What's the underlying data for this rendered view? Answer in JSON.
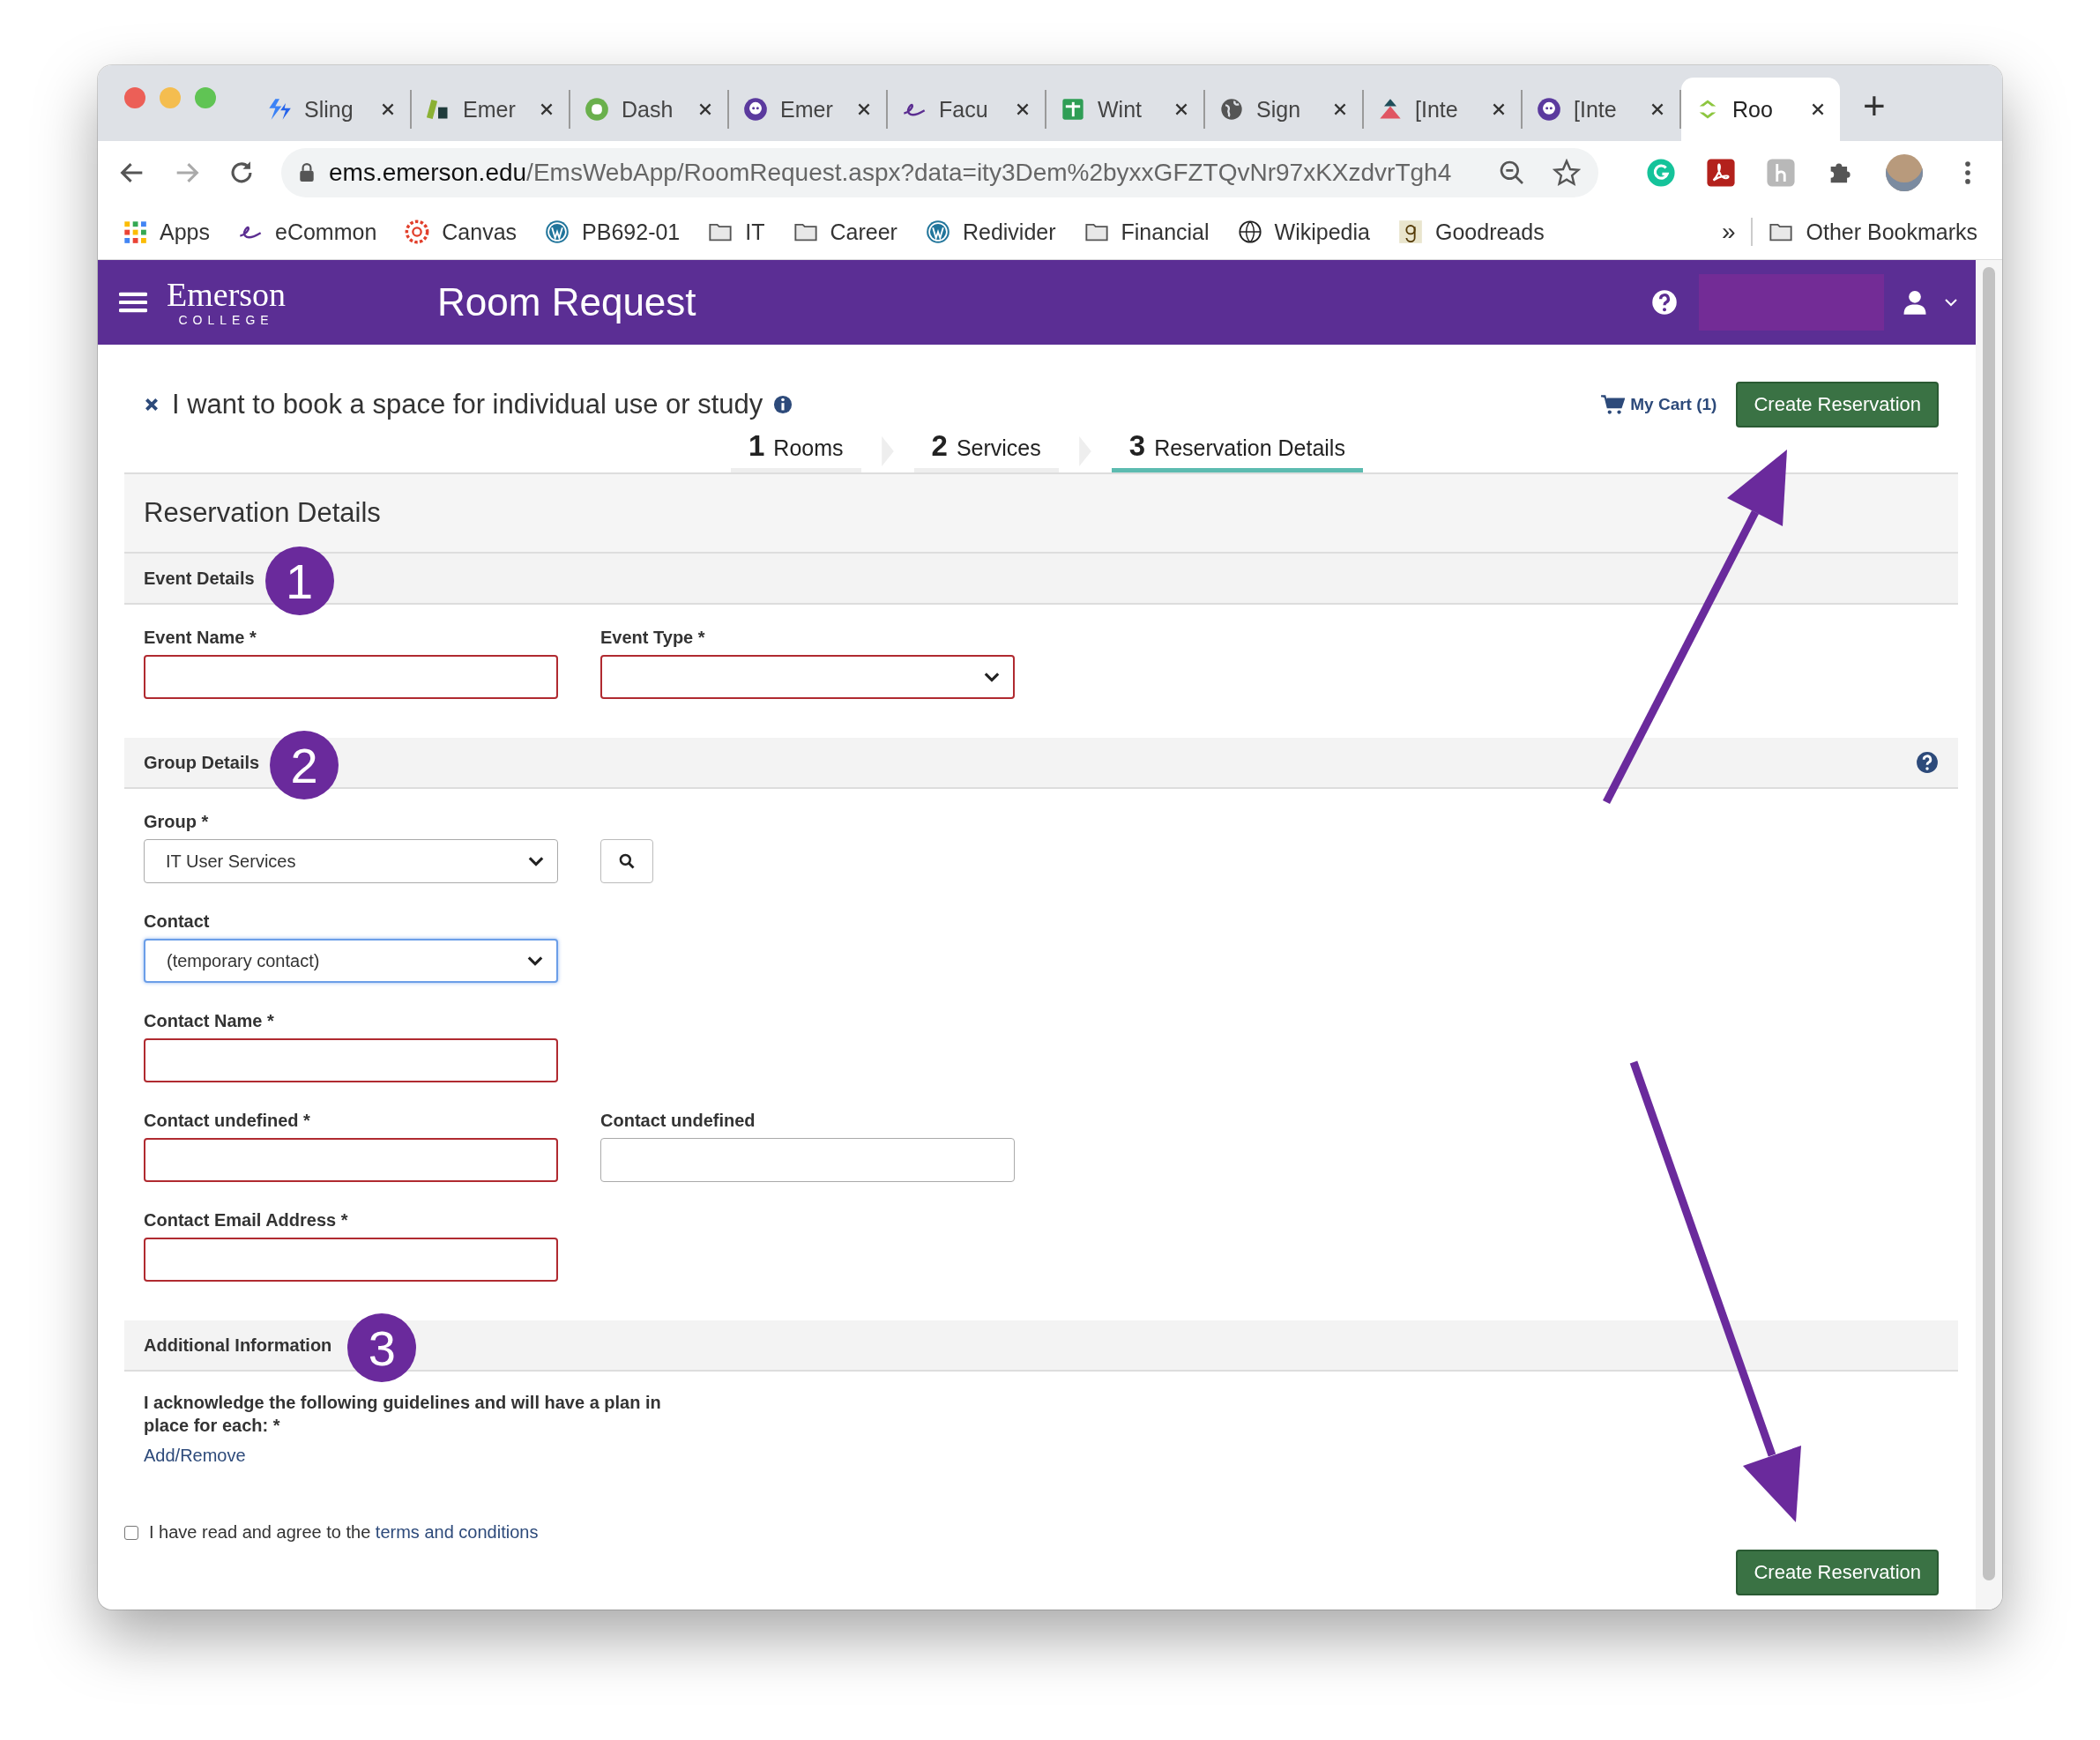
{
  "browser": {
    "tabs": [
      {
        "title": "Sling",
        "kind": "bolt",
        "selected": false
      },
      {
        "title": "Emer",
        "kind": "books",
        "selected": false
      },
      {
        "title": "Dash",
        "kind": "dash",
        "selected": false
      },
      {
        "title": "Emer",
        "kind": "bot",
        "selected": false
      },
      {
        "title": "Facu",
        "kind": "scribble",
        "selected": false
      },
      {
        "title": "Wint",
        "kind": "sheet",
        "selected": false
      },
      {
        "title": "Sign",
        "kind": "globe",
        "selected": false
      },
      {
        "title": "[Inte",
        "kind": "mountain",
        "selected": false
      },
      {
        "title": "[Inte",
        "kind": "bot",
        "selected": false
      },
      {
        "title": "Roo",
        "kind": "arrows",
        "selected": true
      }
    ],
    "new_tab": "+",
    "address": {
      "host": "ems.emerson.edu",
      "path": "/EmsWebApp/RoomRequest.aspx?data=ity3Dem%2byxxGFZTQvNr97xKXzdvrTgh4"
    },
    "bookmarks": [
      {
        "label": "Apps",
        "kind": "apps"
      },
      {
        "label": "eCommon",
        "kind": "scribble"
      },
      {
        "label": "Canvas",
        "kind": "canvas"
      },
      {
        "label": "PB692-01",
        "kind": "wordpress"
      },
      {
        "label": "IT",
        "kind": "folder"
      },
      {
        "label": "Career",
        "kind": "folder"
      },
      {
        "label": "Redivider",
        "kind": "wordpress"
      },
      {
        "label": "Financial",
        "kind": "folder"
      },
      {
        "label": "Wikipedia",
        "kind": "wiki"
      },
      {
        "label": "Goodreads",
        "kind": "goodreads"
      }
    ],
    "more": "»",
    "other_bookmarks": "Other Bookmarks"
  },
  "header": {
    "logo_name": "Emerson",
    "logo_sub": "COLLEGE",
    "title": "Room Request"
  },
  "booking": {
    "title": "I want to book a space for individual use or study",
    "cart": "My Cart (1)",
    "create_button": "Create Reservation"
  },
  "steps": [
    {
      "number": "1",
      "label": "Rooms",
      "selected": false
    },
    {
      "number": "2",
      "label": "Services",
      "selected": false
    },
    {
      "number": "3",
      "label": "Reservation Details",
      "selected": true
    }
  ],
  "panel_title": "Reservation Details",
  "sections": [
    {
      "title": "Event Details",
      "annotation": "1",
      "help": false,
      "rows": [
        [
          {
            "label": "Event Name *",
            "kind": "text",
            "invalid": true,
            "focused": false
          },
          {
            "label": "Event Type *",
            "kind": "select",
            "invalid": true,
            "focused": false
          }
        ]
      ]
    },
    {
      "title": "Group Details",
      "annotation": "2",
      "help": true,
      "rows": [
        [
          {
            "label": "Group *",
            "kind": "select",
            "value": "IT User Services",
            "search": true,
            "invalid": false,
            "focused": false
          }
        ],
        [
          {
            "label": "Contact",
            "kind": "select",
            "value": "(temporary contact)",
            "invalid": false,
            "focused": true
          }
        ],
        [
          {
            "label": "Contact Name *",
            "kind": "text",
            "invalid": true,
            "focused": false
          }
        ],
        [
          {
            "label": "Contact undefined *",
            "kind": "text",
            "invalid": true,
            "focused": false
          },
          {
            "label": "Contact undefined",
            "kind": "text",
            "invalid": false,
            "focused": false
          }
        ],
        [
          {
            "label": "Contact Email Address *",
            "kind": "text",
            "invalid": true,
            "focused": false
          }
        ]
      ]
    },
    {
      "title": "Additional Information",
      "annotation": "3",
      "help": false
    }
  ],
  "acknowledge": {
    "text": "I acknowledge the following guidelines and will have a plan in place for each: *",
    "link": "Add/Remove"
  },
  "agree": {
    "text": "I have read and agree to the ",
    "link": "terms and conditions",
    "checked": false
  },
  "bottom_button": "Create Reservation"
}
